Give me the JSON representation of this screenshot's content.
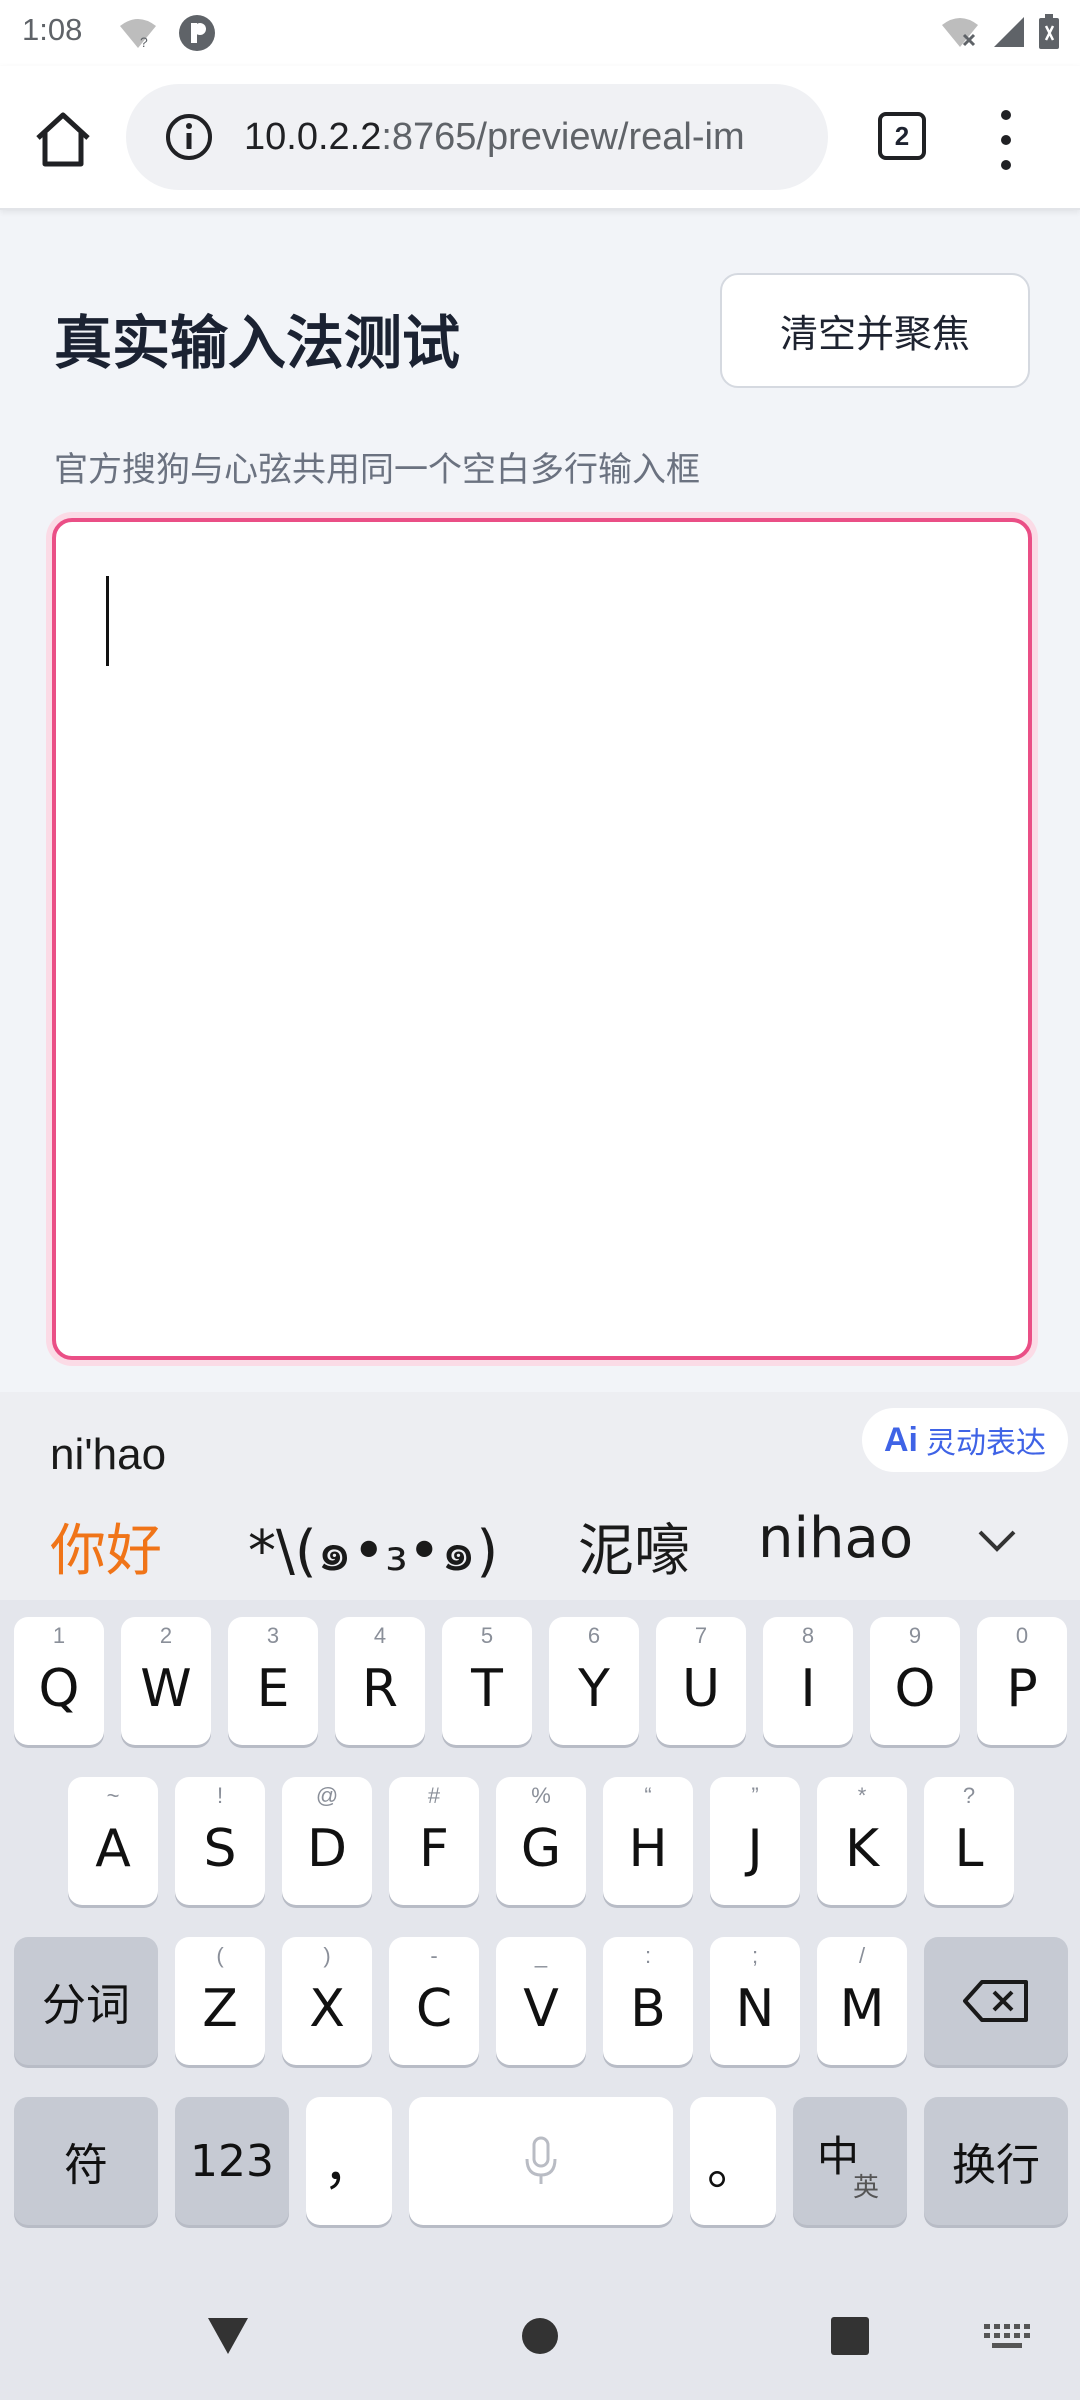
{
  "status": {
    "time": "1:08"
  },
  "browser": {
    "url_host": "10.0.2.2",
    "url_path": ":8765/preview/real-im",
    "tab_count": "2"
  },
  "page": {
    "title": "真实输入法测试",
    "clear_button": "清空并聚焦",
    "subtitle": "官方搜狗与心弦共用同一个空白多行输入框"
  },
  "ime": {
    "pinyin": "ni'hao",
    "ai_label": "灵动表达",
    "ai_mark": "Ai",
    "candidates": [
      "你好",
      "*\\(๑•₃•๑)",
      "泥嚎",
      "nihao"
    ],
    "row1": [
      {
        "key": "Q",
        "hint": "1"
      },
      {
        "key": "W",
        "hint": "2"
      },
      {
        "key": "E",
        "hint": "3"
      },
      {
        "key": "R",
        "hint": "4"
      },
      {
        "key": "T",
        "hint": "5"
      },
      {
        "key": "Y",
        "hint": "6"
      },
      {
        "key": "U",
        "hint": "7"
      },
      {
        "key": "I",
        "hint": "8"
      },
      {
        "key": "O",
        "hint": "9"
      },
      {
        "key": "P",
        "hint": "0"
      }
    ],
    "row2": [
      {
        "key": "A",
        "hint": "~"
      },
      {
        "key": "S",
        "hint": "!"
      },
      {
        "key": "D",
        "hint": "@"
      },
      {
        "key": "F",
        "hint": "#"
      },
      {
        "key": "G",
        "hint": "%"
      },
      {
        "key": "H",
        "hint": "“"
      },
      {
        "key": "J",
        "hint": "”"
      },
      {
        "key": "K",
        "hint": "*"
      },
      {
        "key": "L",
        "hint": "?"
      }
    ],
    "row3": [
      {
        "key": "Z",
        "hint": "("
      },
      {
        "key": "X",
        "hint": ")"
      },
      {
        "key": "C",
        "hint": "-"
      },
      {
        "key": "V",
        "hint": "_"
      },
      {
        "key": "B",
        "hint": ":"
      },
      {
        "key": "N",
        "hint": ";"
      },
      {
        "key": "M",
        "hint": "/"
      }
    ],
    "segment_key": "分词",
    "symbol_key": "符",
    "number_key": "123",
    "comma_key": "，",
    "period_key": "。",
    "lang_key_main": "中",
    "lang_key_sub": "英",
    "enter_key": "换行"
  }
}
